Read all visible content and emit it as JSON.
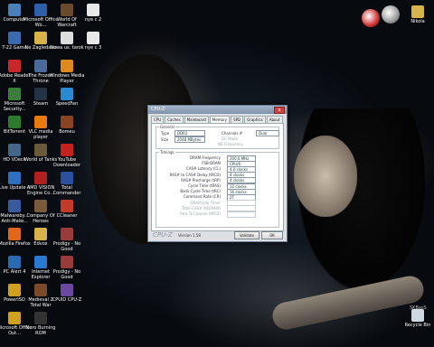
{
  "desktop": {
    "watermark": "SKBasS",
    "icons": [
      {
        "label": "Computer",
        "icon": "computer-icon",
        "color": "#4b7fb8",
        "col": 0,
        "row": 0
      },
      {
        "label": "Microsoft Office Wo...",
        "icon": "word-icon",
        "color": "#2f5fa8",
        "col": 1,
        "row": 0
      },
      {
        "label": "World Of Warcraft",
        "icon": "wow-icon",
        "color": "#6a4a2a",
        "col": 2,
        "row": 0
      },
      {
        "label": "nye c 2",
        "icon": "document-icon",
        "color": "#e8e8e8",
        "col": 3,
        "row": 0
      },
      {
        "label": "T-22 Game",
        "icon": "game-icon",
        "color": "#3a6ab0",
        "col": 0,
        "row": 1
      },
      {
        "label": "Ne Zagledano",
        "icon": "folder-icon",
        "color": "#d6b44a",
        "col": 1,
        "row": 1
      },
      {
        "label": "Nowa us. tarok",
        "icon": "document-icon",
        "color": "#dddddd",
        "col": 2,
        "row": 1
      },
      {
        "label": "nye c 3",
        "icon": "document-icon",
        "color": "#e8e8e8",
        "col": 3,
        "row": 1
      },
      {
        "label": "Adobe Reader X",
        "icon": "pdf-icon",
        "color": "#c8262b",
        "col": 0,
        "row": 2
      },
      {
        "label": "The Frozen Throne",
        "icon": "warcraft-icon",
        "color": "#4a6a9a",
        "col": 1,
        "row": 2
      },
      {
        "label": "Windows Media Player",
        "icon": "media-player-icon",
        "color": "#e08a1e",
        "col": 2,
        "row": 2
      },
      {
        "label": "Microsoft Security...",
        "icon": "shield-icon",
        "color": "#3b7d3b",
        "col": 0,
        "row": 3
      },
      {
        "label": "Steam",
        "icon": "steam-icon",
        "color": "#223344",
        "col": 1,
        "row": 3
      },
      {
        "label": "SpeedFan",
        "icon": "fan-icon",
        "color": "#2a8ad0",
        "col": 2,
        "row": 3
      },
      {
        "label": "BitTorrent",
        "icon": "torrent-icon",
        "color": "#2c7a2c",
        "col": 0,
        "row": 4
      },
      {
        "label": "VLC media player",
        "icon": "vlc-icon",
        "color": "#e87a10",
        "col": 1,
        "row": 4
      },
      {
        "label": "Bomeu",
        "icon": "app-icon",
        "color": "#884422",
        "col": 2,
        "row": 4
      },
      {
        "label": "HD VDeck",
        "icon": "sound-icon",
        "color": "#446688",
        "col": 0,
        "row": 5
      },
      {
        "label": "World of Tanks",
        "icon": "tank-icon",
        "color": "#6a5a3a",
        "col": 1,
        "row": 5
      },
      {
        "label": "YouTube Downloader",
        "icon": "youtube-icon",
        "color": "#c42020",
        "col": 2,
        "row": 5
      },
      {
        "label": "Live Update 4",
        "icon": "update-icon",
        "color": "#2f6fbf",
        "col": 0,
        "row": 6
      },
      {
        "label": "AMD VISION Engine Co...",
        "icon": "amd-icon",
        "color": "#b02020",
        "col": 1,
        "row": 6
      },
      {
        "label": "Total Commander",
        "icon": "commander-icon",
        "color": "#2c4f9e",
        "col": 2,
        "row": 6
      },
      {
        "label": "Malwareby... Anti-Malw...",
        "icon": "malware-icon",
        "color": "#3a5aa0",
        "col": 0,
        "row": 7
      },
      {
        "label": "Company Of Heroes",
        "icon": "coh-icon",
        "color": "#7a5a3a",
        "col": 1,
        "row": 7
      },
      {
        "label": "CCleaner",
        "icon": "ccleaner-icon",
        "color": "#c43a2a",
        "col": 2,
        "row": 7
      },
      {
        "label": "Mozilla Firefox",
        "icon": "firefox-icon",
        "color": "#e0661a",
        "col": 0,
        "row": 8
      },
      {
        "label": "Edvox",
        "icon": "folder-icon",
        "color": "#d6b44a",
        "col": 1,
        "row": 8
      },
      {
        "label": "Prodigy - No Good",
        "icon": "music-icon",
        "color": "#9a3a3a",
        "col": 2,
        "row": 8
      },
      {
        "label": "PC Alert 4",
        "icon": "alert-icon",
        "color": "#2a6ab0",
        "col": 0,
        "row": 9
      },
      {
        "label": "Internet Explorer",
        "icon": "ie-icon",
        "color": "#2a7ad0",
        "col": 1,
        "row": 9
      },
      {
        "label": "Prodigy - No Good",
        "icon": "music-icon",
        "color": "#9a3a3a",
        "col": 2,
        "row": 9
      },
      {
        "label": "PowerISO",
        "icon": "iso-icon",
        "color": "#d0a020",
        "col": 0,
        "row": 10
      },
      {
        "label": "Medieval 2 Total War",
        "icon": "medieval-icon",
        "color": "#7a4a2a",
        "col": 1,
        "row": 10
      },
      {
        "label": "CPUID CPU-Z",
        "icon": "cpuz-icon",
        "color": "#6a4aa0",
        "col": 2,
        "row": 10
      },
      {
        "label": "Microsoft Office Out...",
        "icon": "outlook-icon",
        "color": "#d0a020",
        "col": 0,
        "row": 11
      },
      {
        "label": "Nero Burning ROM",
        "icon": "nero-icon",
        "color": "#333333",
        "col": 1,
        "row": 11
      }
    ],
    "right_icons": [
      {
        "label": "Nikola",
        "icon": "user-folder-icon",
        "color": "#d6b44a"
      },
      {
        "label": "Recycle Bin",
        "icon": "recycle-bin-icon",
        "color": "#cfd8e0"
      }
    ]
  },
  "cpuz": {
    "title": "CPU-Z",
    "close": "x",
    "tabs": [
      "CPU",
      "Caches",
      "Mainboard",
      "Memory",
      "SPD",
      "Graphics",
      "About"
    ],
    "active_tab": "Memory",
    "general": {
      "title": "General",
      "type_label": "Type",
      "type_value": "DDR2",
      "size_label": "Size",
      "size_value": "2048 MBytes",
      "channel_label": "Channels #",
      "channel_value": "Dual",
      "dcmode_label": "DC Mode",
      "nbfreq_label": "NB Frequency"
    },
    "timings": {
      "title": "Timings",
      "rows": [
        {
          "label": "DRAM Frequency",
          "value": "200.0 MHz"
        },
        {
          "label": "FSB:DRAM",
          "value": "CPU/6"
        },
        {
          "label": "CAS# Latency (CL)",
          "value": "4.0 clocks"
        },
        {
          "label": "RAS# to CAS# Delay (tRCD)",
          "value": "4 clocks"
        },
        {
          "label": "RAS# Precharge (tRP)",
          "value": "4 clocks"
        },
        {
          "label": "Cycle Time (tRAS)",
          "value": "12 clocks"
        },
        {
          "label": "Bank Cycle Time (tRC)",
          "value": "16 clocks"
        },
        {
          "label": "Command Rate (CR)",
          "value": "2T"
        }
      ],
      "grey_rows": [
        "DRAM Idle Timer",
        "Total CAS# (tRDRAM)",
        "Row To Column (tRCD)"
      ]
    },
    "footer": {
      "logo": "CPU-Z",
      "version": "Version 1.58",
      "validate": "Validate",
      "ok": "OK"
    }
  }
}
